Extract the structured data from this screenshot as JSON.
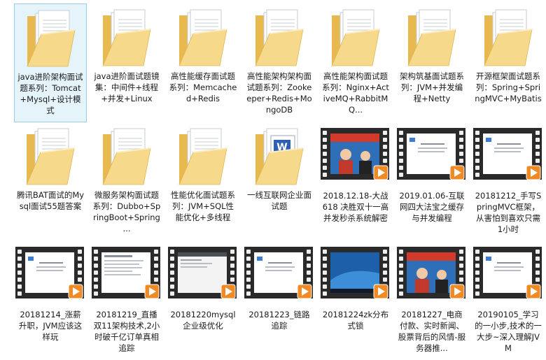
{
  "colors": {
    "folder_back": "#e8b94e",
    "folder_front": "#f6d98a",
    "selection_bg": "#e5f3fb",
    "selection_border": "#9ccaeb",
    "play_orange": "#f08a24"
  },
  "items": [
    {
      "type": "folder",
      "label": "java进阶架构面试题系列：Tomcat+Mysql+设计模式",
      "selected": true
    },
    {
      "type": "folder",
      "label": "java进阶面试题镜集：中间件+线程+并发+Linux"
    },
    {
      "type": "folder",
      "label": "高性能缓存面试题系列：Memcached+Redis"
    },
    {
      "type": "folder",
      "label": "高性能架构架构面试题系列：Zookeeper+Redis+MongoDB"
    },
    {
      "type": "folder",
      "label": "高性能架构面试题系列：Nginx+ActiveMQ+RabbitMQ..."
    },
    {
      "type": "folder",
      "label": "架构筑基面试题系列：JVM+并发编程+Netty"
    },
    {
      "type": "folder",
      "label": "开源框架面试题系列：Spring+SpringMVC+MyBatis"
    },
    {
      "type": "folder",
      "label": "腾讯BAT面试的Mysql面试55题答案"
    },
    {
      "type": "folder",
      "label": "微服务架构面试题系列：Dubbo+SpringBoot+Spring ..."
    },
    {
      "type": "folder",
      "label": "性能优化面试题系列：JVM+SQL性能优化+多线程"
    },
    {
      "type": "folder",
      "label": "一线互联网企业面试题",
      "word": true
    },
    {
      "type": "video",
      "label": "2018.12.18-大战618 决胜双十一高并发秒杀系统解密",
      "thumb": "people"
    },
    {
      "type": "video",
      "label": "2019.01.06-互联网四大法宝之缓存与并发编程",
      "thumb": "slide"
    },
    {
      "type": "video",
      "label": "20181212_手写SpringMVC框架，从害怕到喜欢只需1小时",
      "thumb": "slide"
    },
    {
      "type": "video",
      "label": "20181214_涨薪升职，JVM应该这样玩",
      "thumb": "slide"
    },
    {
      "type": "video",
      "label": "20181219_直播双11架构技术,2小时破千亿订单真相追踪",
      "thumb": "doc"
    },
    {
      "type": "video",
      "label": "20181220mysql企业级优化",
      "thumb": "screen"
    },
    {
      "type": "video",
      "label": "20181223_链路追踪",
      "thumb": "slide"
    },
    {
      "type": "video",
      "label": "20181224zk分布式锁",
      "thumb": "desktop"
    },
    {
      "type": "video",
      "label": "20181227_电商付款、实时新闻、股票背后的风情-服务器推...",
      "thumb": "people"
    },
    {
      "type": "video",
      "label": "20190105_学习的一小步,技术的一大步~深入理解JVM",
      "thumb": "slide"
    }
  ]
}
